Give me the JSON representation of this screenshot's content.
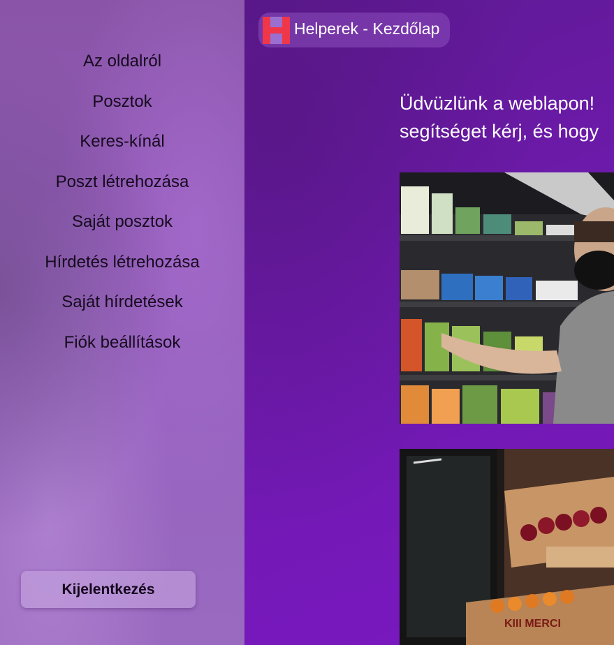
{
  "app": {
    "title": "Helperek - Kezdőlap",
    "logo_letter": "H",
    "brand_color": "#f0374a"
  },
  "sidebar": {
    "items": [
      {
        "label": "Az oldalról"
      },
      {
        "label": "Posztok"
      },
      {
        "label": "Keres-kínál"
      },
      {
        "label": "Poszt létrehozása"
      },
      {
        "label": "Saját posztok"
      },
      {
        "label": "Hírdetés létrehozása"
      },
      {
        "label": "Saját hírdetések"
      },
      {
        "label": "Fiók beállítások"
      }
    ],
    "logout_label": "Kijelentkezés"
  },
  "main": {
    "welcome_line1": "Üdvüzlünk a weblapon!",
    "welcome_line2": "segítséget kérj, és hogy",
    "images": [
      {
        "name": "grocery-shelf-photo"
      },
      {
        "name": "fruit-crates-photo",
        "crate_text": "KIII MERCI"
      }
    ]
  },
  "colors": {
    "sidebar": "#9562be",
    "main": "#6d1aab",
    "text_dark": "#160b1e"
  }
}
